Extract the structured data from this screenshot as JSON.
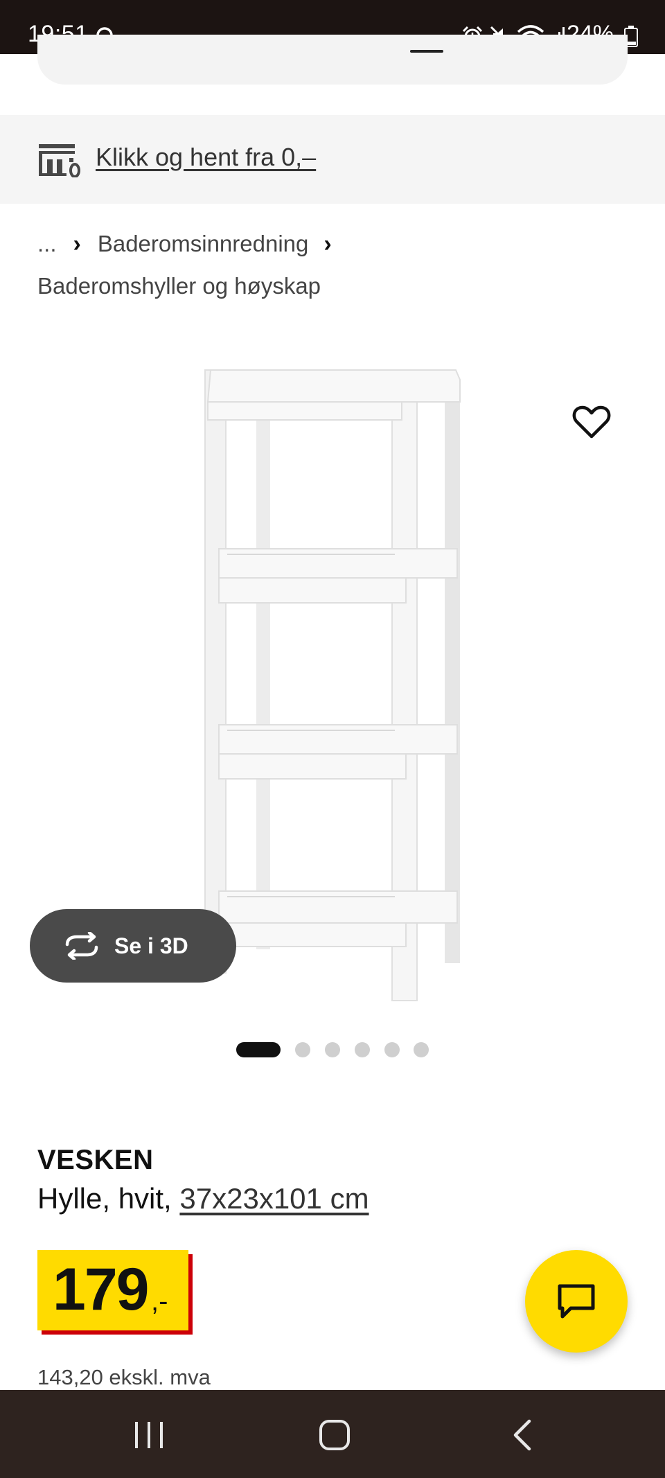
{
  "status_bar": {
    "time": "19:51",
    "battery": "24%",
    "icons": [
      "search-icon",
      "alarm-icon",
      "mute-icon",
      "wifi-icon",
      "signal-icon",
      "battery-icon"
    ]
  },
  "banner": {
    "text": "Klikk og hent fra 0,–",
    "icon": "store-pickup-icon"
  },
  "breadcrumb": {
    "ellipsis": "...",
    "level1": "Baderomsinnredning",
    "level2": "Baderomshyller og høyskap"
  },
  "gallery": {
    "button_3d": "Se i 3D",
    "dots_total": 6,
    "active_dot": 1,
    "favorite_icon": "heart-icon"
  },
  "product": {
    "name": "VESKEN",
    "description_prefix": "Hylle, hvit, ",
    "size": "37x23x101 cm",
    "price_integer": "179",
    "price_suffix": ",-",
    "price_excl_vat": "143,20 ekskl. mva"
  },
  "colors": {
    "brand_yellow": "#ffdb00",
    "brand_red": "#cc0008",
    "status_bar": "#1c1412",
    "nav_bar": "#2e231f"
  }
}
